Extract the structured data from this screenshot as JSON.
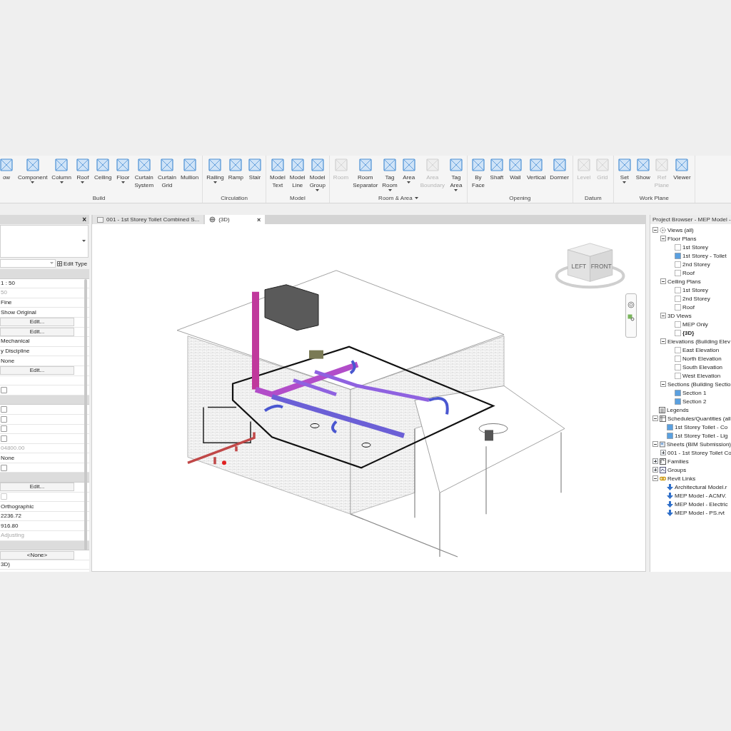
{
  "ribbon": {
    "panels": [
      {
        "title": "Build",
        "dropdown": false,
        "tools": [
          {
            "label": "ow",
            "dropdown": false,
            "disabled": false
          },
          {
            "label": "Component",
            "dropdown": true,
            "disabled": false
          },
          {
            "label": "Column",
            "dropdown": true,
            "disabled": false
          },
          {
            "label": "Roof",
            "dropdown": true,
            "disabled": false
          },
          {
            "label": "Ceiling",
            "dropdown": false,
            "disabled": false
          },
          {
            "label": "Floor",
            "dropdown": true,
            "disabled": false
          },
          {
            "label": "Curtain System",
            "dropdown": false,
            "disabled": false
          },
          {
            "label": "Curtain Grid",
            "dropdown": false,
            "disabled": false
          },
          {
            "label": "Mullion",
            "dropdown": false,
            "disabled": false
          }
        ]
      },
      {
        "title": "Circulation",
        "dropdown": false,
        "tools": [
          {
            "label": "Railing",
            "dropdown": true,
            "disabled": false
          },
          {
            "label": "Ramp",
            "dropdown": false,
            "disabled": false
          },
          {
            "label": "Stair",
            "dropdown": false,
            "disabled": false
          }
        ]
      },
      {
        "title": "Model",
        "dropdown": false,
        "tools": [
          {
            "label": "Model Text",
            "dropdown": false,
            "disabled": false
          },
          {
            "label": "Model Line",
            "dropdown": false,
            "disabled": false
          },
          {
            "label": "Model Group",
            "dropdown": true,
            "disabled": false
          }
        ]
      },
      {
        "title": "Room & Area",
        "dropdown": true,
        "tools": [
          {
            "label": "Room",
            "dropdown": false,
            "disabled": true
          },
          {
            "label": "Room Separator",
            "dropdown": false,
            "disabled": false
          },
          {
            "label": "Tag Room",
            "dropdown": true,
            "disabled": false
          },
          {
            "label": "Area",
            "dropdown": true,
            "disabled": false
          },
          {
            "label": "Area Boundary",
            "dropdown": false,
            "disabled": true
          },
          {
            "label": "Tag Area",
            "dropdown": true,
            "disabled": false
          }
        ]
      },
      {
        "title": "Opening",
        "dropdown": false,
        "tools": [
          {
            "label": "By Face",
            "dropdown": false,
            "disabled": false
          },
          {
            "label": "Shaft",
            "dropdown": false,
            "disabled": false
          },
          {
            "label": "Wall",
            "dropdown": false,
            "disabled": false
          },
          {
            "label": "Vertical",
            "dropdown": false,
            "disabled": false
          },
          {
            "label": "Dormer",
            "dropdown": false,
            "disabled": false
          }
        ]
      },
      {
        "title": "Datum",
        "dropdown": false,
        "tools": [
          {
            "label": "Level",
            "dropdown": false,
            "disabled": true
          },
          {
            "label": "Grid",
            "dropdown": false,
            "disabled": true
          }
        ]
      },
      {
        "title": "Work Plane",
        "dropdown": false,
        "tools": [
          {
            "label": "Set",
            "dropdown": true,
            "disabled": false
          },
          {
            "label": "Show",
            "dropdown": false,
            "disabled": false
          },
          {
            "label": "Ref Plane",
            "dropdown": false,
            "disabled": true
          },
          {
            "label": "Viewer",
            "dropdown": false,
            "disabled": false
          }
        ]
      }
    ]
  },
  "properties": {
    "close": "×",
    "edit_type": "Edit Type",
    "rows": [
      {
        "kind": "header"
      },
      {
        "kind": "text",
        "value": "1 : 50",
        "disabled": false
      },
      {
        "kind": "text",
        "value": "50",
        "disabled": true
      },
      {
        "kind": "text",
        "value": "Fine",
        "disabled": false
      },
      {
        "kind": "text",
        "value": "Show Original",
        "disabled": false
      },
      {
        "kind": "button",
        "value": "Edit..."
      },
      {
        "kind": "button",
        "value": "Edit..."
      },
      {
        "kind": "text",
        "value": "Mechanical",
        "disabled": false
      },
      {
        "kind": "text",
        "value": "y Discipline",
        "disabled": false
      },
      {
        "kind": "text",
        "value": "None",
        "disabled": false
      },
      {
        "kind": "button",
        "value": "Edit..."
      },
      {
        "kind": "blank"
      },
      {
        "kind": "checkbox",
        "checked": false,
        "disabled": false
      },
      {
        "kind": "header"
      },
      {
        "kind": "checkbox",
        "checked": false,
        "disabled": false
      },
      {
        "kind": "checkbox",
        "checked": false,
        "disabled": false
      },
      {
        "kind": "checkbox",
        "checked": false,
        "disabled": false
      },
      {
        "kind": "checkbox",
        "checked": false,
        "disabled": false
      },
      {
        "kind": "text",
        "value": "04800.00",
        "disabled": true
      },
      {
        "kind": "text",
        "value": "None",
        "disabled": false
      },
      {
        "kind": "checkbox",
        "checked": false,
        "disabled": false
      },
      {
        "kind": "header"
      },
      {
        "kind": "button",
        "value": "Edit..."
      },
      {
        "kind": "checkbox",
        "checked": false,
        "disabled": true
      },
      {
        "kind": "text",
        "value": "Orthographic",
        "disabled": false
      },
      {
        "kind": "text",
        "value": "2236.72",
        "disabled": false
      },
      {
        "kind": "text",
        "value": "916.80",
        "disabled": false
      },
      {
        "kind": "text",
        "value": "Adjusting",
        "disabled": true
      },
      {
        "kind": "header"
      },
      {
        "kind": "button",
        "value": "<None>"
      },
      {
        "kind": "text",
        "value": "3D)",
        "disabled": false
      }
    ]
  },
  "tabs": [
    {
      "label": "001 - 1st Storey Toilet Combined S...",
      "selected": false
    },
    {
      "label": "(3D)",
      "selected": true,
      "close": "×"
    }
  ],
  "view_cube": {
    "faces": [
      "LEFT",
      "FRONT"
    ]
  },
  "project_browser": {
    "title": "Project Browser - MEP Model -",
    "tree": [
      {
        "label": "Views (all)",
        "kind": "root",
        "expanded": true,
        "children": [
          {
            "label": "Floor Plans",
            "kind": "folder",
            "expanded": true,
            "children": [
              {
                "label": "1st Storey",
                "kind": "view",
                "on_sheet": false,
                "selected": false
              },
              {
                "label": "1st Storey - Toilet",
                "kind": "view",
                "on_sheet": true,
                "selected": false
              },
              {
                "label": "2nd Storey",
                "kind": "view",
                "on_sheet": false,
                "selected": false
              },
              {
                "label": "Roof",
                "kind": "view",
                "on_sheet": false,
                "selected": false
              }
            ]
          },
          {
            "label": "Ceiling Plans",
            "kind": "folder",
            "expanded": true,
            "children": [
              {
                "label": "1st Storey",
                "kind": "view",
                "on_sheet": false,
                "selected": false
              },
              {
                "label": "2nd Storey",
                "kind": "view",
                "on_sheet": false,
                "selected": false
              },
              {
                "label": "Roof",
                "kind": "view",
                "on_sheet": false,
                "selected": false
              }
            ]
          },
          {
            "label": "3D Views",
            "kind": "folder",
            "expanded": true,
            "children": [
              {
                "label": "MEP Only",
                "kind": "view",
                "on_sheet": false,
                "selected": false
              },
              {
                "label": "{3D}",
                "kind": "view",
                "on_sheet": false,
                "selected": true
              }
            ]
          },
          {
            "label": "Elevations (Building Elev",
            "kind": "folder",
            "expanded": true,
            "children": [
              {
                "label": "East Elevation",
                "kind": "view",
                "on_sheet": false,
                "selected": false
              },
              {
                "label": "North Elevation",
                "kind": "view",
                "on_sheet": false,
                "selected": false
              },
              {
                "label": "South Elevation",
                "kind": "view",
                "on_sheet": false,
                "selected": false
              },
              {
                "label": "West Elevation",
                "kind": "view",
                "on_sheet": false,
                "selected": false
              }
            ]
          },
          {
            "label": "Sections (Building Sectio",
            "kind": "folder",
            "expanded": true,
            "children": [
              {
                "label": "Section 1",
                "kind": "view",
                "on_sheet": true,
                "selected": false
              },
              {
                "label": "Section 2",
                "kind": "view",
                "on_sheet": true,
                "selected": false
              }
            ]
          }
        ]
      },
      {
        "label": "Legends",
        "kind": "legends"
      },
      {
        "label": "Schedules/Quantities (all",
        "kind": "schedules",
        "expanded": true,
        "children": [
          {
            "label": "1st Storey Toilet - Co",
            "kind": "view",
            "on_sheet": true,
            "selected": false
          },
          {
            "label": "1st Storey Toilet - Lig",
            "kind": "view",
            "on_sheet": true,
            "selected": false
          }
        ]
      },
      {
        "label": "Sheets (BIM Submission)",
        "kind": "sheets",
        "expanded": true,
        "children": [
          {
            "label": "001 - 1st Storey Toilet Co",
            "kind": "folder",
            "expanded": false
          }
        ]
      },
      {
        "label": "Families",
        "kind": "families",
        "expanded": false
      },
      {
        "label": "Groups",
        "kind": "groups",
        "expanded": false
      },
      {
        "label": "Revit Links",
        "kind": "links",
        "expanded": true,
        "children": [
          {
            "label": "Architectural Model.r",
            "kind": "link"
          },
          {
            "label": "MEP Model - ACMV.",
            "kind": "link"
          },
          {
            "label": "MEP Model - Electric",
            "kind": "link"
          },
          {
            "label": "MEP Model - PS.rvt",
            "kind": "link"
          }
        ]
      }
    ]
  }
}
